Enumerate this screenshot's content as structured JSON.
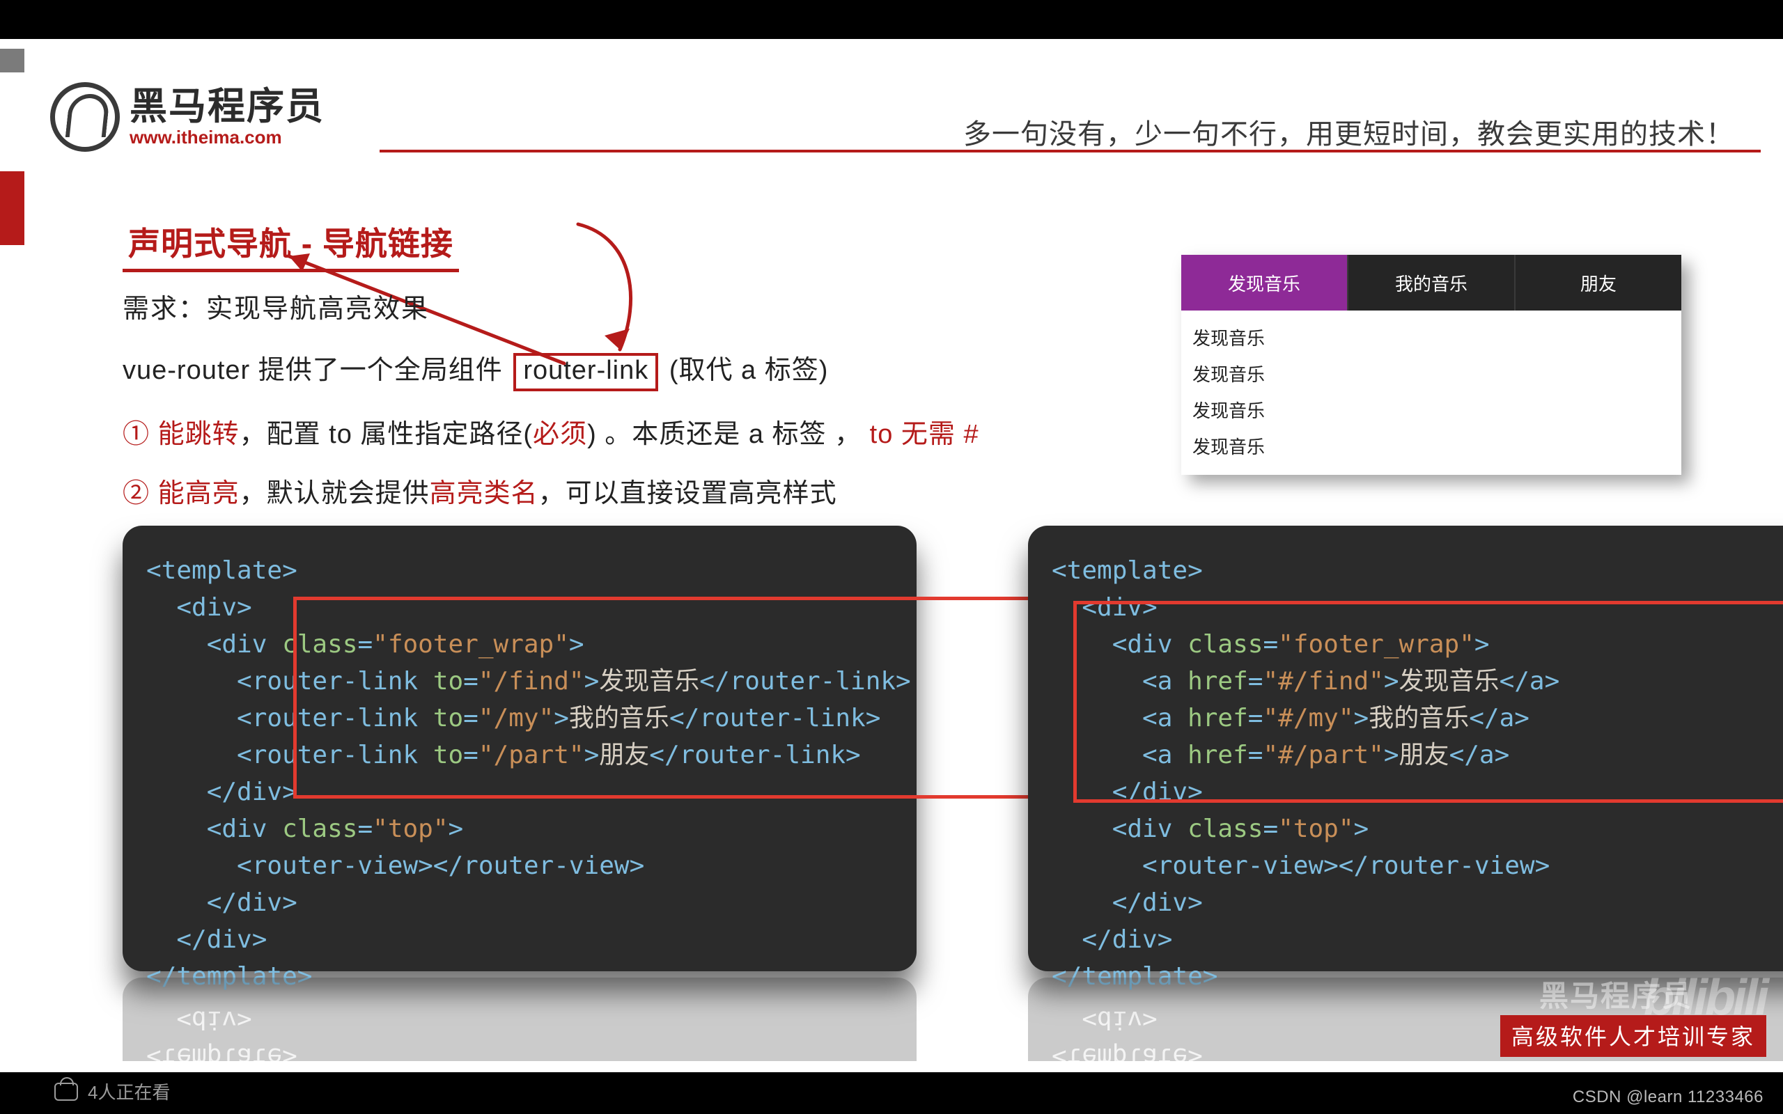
{
  "brand": {
    "cn": "黑马程序员",
    "url": "www.itheima.com"
  },
  "slogan": "多一句没有，少一句不行，用更短时间，教会更实用的技术！",
  "title": "声明式导航 - 导航链接",
  "l1_a": "需求：",
  "l1_b": "实现导航高亮效果",
  "l2_a": "vue-router 提供了一个全局组件 ",
  "l2_box": "router-link",
  "l2_c": " (取代 a 标签)",
  "l3_a": "① ",
  "l3_b": "能跳转",
  "l3_c": "，配置 to 属性指定路径(",
  "l3_d": "必须",
  "l3_e": ") 。本质还是 a 标签 ， ",
  "l3_f": "to 无需 #",
  "l4_a": "② ",
  "l4_b": "能高亮",
  "l4_c": "，默认就会提供",
  "l4_d": "高亮类名",
  "l4_e": "，可以直接设置高亮样式",
  "preview": {
    "tabs": [
      "发现音乐",
      "我的音乐",
      "朋友"
    ],
    "items": [
      "发现音乐",
      "发现音乐",
      "发现音乐",
      "发现音乐"
    ]
  },
  "codeL": {
    "l1": "<template>",
    "l2": "  <div>",
    "l3a": "    <div ",
    "l3b": "class",
    "l3c": "=",
    "l3d": "\"footer_wrap\"",
    "l3e": ">",
    "l4a": "      <router-link ",
    "l4b": "to",
    "l4d": "\"/find\"",
    "l4e": ">",
    "l4t": "发现音乐",
    "l4f": "</router-link>",
    "l5a": "      <router-link ",
    "l5d": "\"/my\"",
    "l5t": "我的音乐",
    "l6a": "      <router-link ",
    "l6d": "\"/part\"",
    "l6t": "朋友",
    "l7": "    </div>",
    "l8a": "    <div ",
    "l8d": "\"top\"",
    "l9": "      <router-view></router-view>",
    "l10": "    </div>",
    "l11": "  </div>",
    "l12": "</template>"
  },
  "codeR": {
    "l4a": "      <a ",
    "l4b": "href",
    "l4d": "\"#/find\"",
    "l4t": "发现音乐",
    "l4f": "</a>",
    "l5d": "\"#/my\"",
    "l5t": "我的音乐",
    "l6d": "\"#/part\"",
    "l6t": "朋友"
  },
  "wm": {
    "brand": "黑马程序员",
    "bili": "bilibili",
    "red": "高级软件人才培训专家"
  },
  "csdn": "CSDN @learn 11233466",
  "viewers": "4人正在看"
}
